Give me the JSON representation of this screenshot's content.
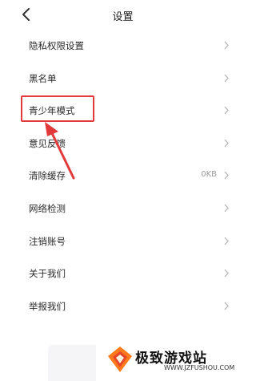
{
  "header": {
    "title": "设置"
  },
  "menu": [
    {
      "label": "隐私权限设置",
      "value": ""
    },
    {
      "label": "黑名单",
      "value": ""
    },
    {
      "label": "青少年模式",
      "value": ""
    },
    {
      "label": "意见反馈",
      "value": ""
    },
    {
      "label": "清除缓存",
      "value": "0KB"
    },
    {
      "label": "网络检测",
      "value": ""
    },
    {
      "label": "注销账号",
      "value": ""
    },
    {
      "label": "关于我们",
      "value": ""
    },
    {
      "label": "举报我们",
      "value": ""
    }
  ],
  "annotation": {
    "highlight_color": "#e23a3a"
  },
  "watermark": {
    "name": "极致游戏站",
    "url": "WWW.JZFUSHOU.COM"
  },
  "icons": {
    "back": "chevron-left-icon",
    "row_arrow": "chevron-right-icon"
  }
}
